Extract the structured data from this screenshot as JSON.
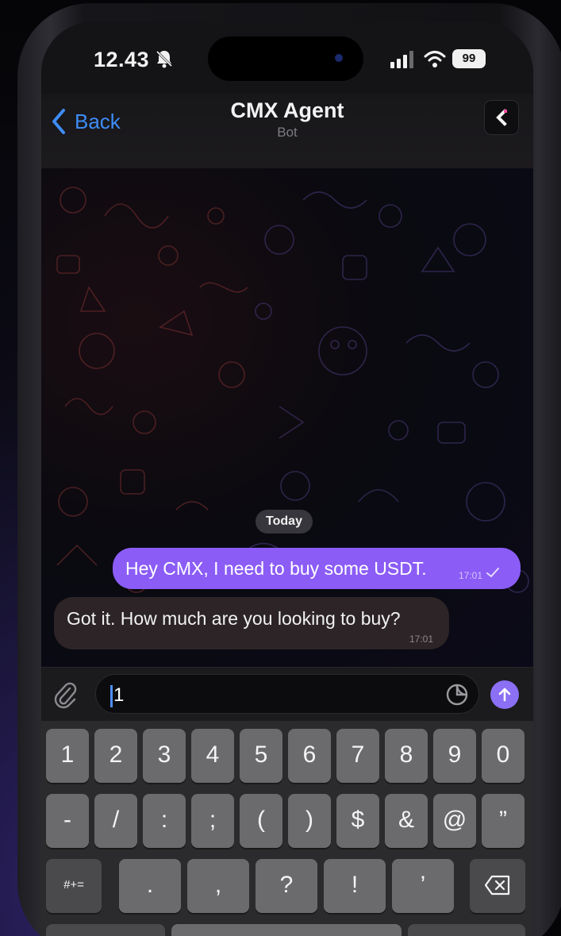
{
  "status_bar": {
    "time": "12.43",
    "battery": "99"
  },
  "nav": {
    "back_label": "Back",
    "title": "CMX Agent",
    "subtitle": "Bot"
  },
  "chat": {
    "date_chip": "Today",
    "messages": [
      {
        "direction": "outgoing",
        "text": "Hey CMX, I need to buy some USDT.",
        "time": "17:01",
        "status": "read"
      },
      {
        "direction": "incoming",
        "text": "Got it. How much are you looking to buy?",
        "time": "17:01"
      }
    ]
  },
  "composer": {
    "value": "1"
  },
  "keyboard": {
    "row1": [
      "1",
      "2",
      "3",
      "4",
      "5",
      "6",
      "7",
      "8",
      "9",
      "0"
    ],
    "row2": [
      "-",
      "/",
      ":",
      ";",
      "(",
      ")",
      "$",
      "&",
      "@",
      "”"
    ],
    "row3": {
      "mode_key": "#+=",
      "keys": [
        ".",
        ",",
        "?",
        "!",
        "’"
      ]
    }
  },
  "colors": {
    "accent": "#8b5cf6",
    "link": "#3e8cf6",
    "incoming_bubble": "#2c2426",
    "keyboard_key": "#6b6b6e"
  }
}
